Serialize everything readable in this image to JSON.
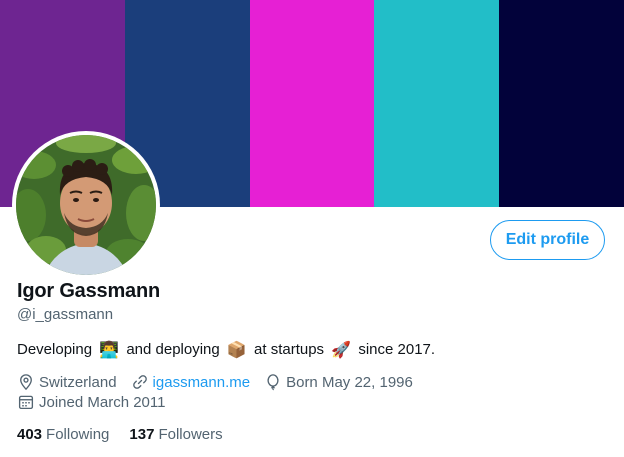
{
  "banner": {
    "stripes": [
      "#6e2591",
      "#1b3e7b",
      "#e620d4",
      "#22bec8",
      "#02023a"
    ]
  },
  "profile": {
    "display_name": "Igor Gassmann",
    "handle": "@i_gassmann",
    "edit_button_label": "Edit profile",
    "bio": {
      "part1": "Developing",
      "emoji1": "👨‍💻",
      "part2": "and deploying",
      "emoji2": "📦",
      "part3": "at startups",
      "emoji3": "🚀",
      "part4": "since 2017."
    },
    "location": "Switzerland",
    "website": "igassmann.me",
    "birthday": "Born May 22, 1996",
    "joined": "Joined March 2011",
    "icons": {
      "location": "location-pin-icon",
      "website": "link-icon",
      "birthday": "balloon-icon",
      "joined": "calendar-icon"
    }
  },
  "stats": {
    "following_count": "403",
    "following_label": "Following",
    "followers_count": "137",
    "followers_label": "Followers"
  },
  "colors": {
    "accent": "#1d9bf0",
    "text_primary": "#0f1419",
    "text_secondary": "#536471"
  }
}
